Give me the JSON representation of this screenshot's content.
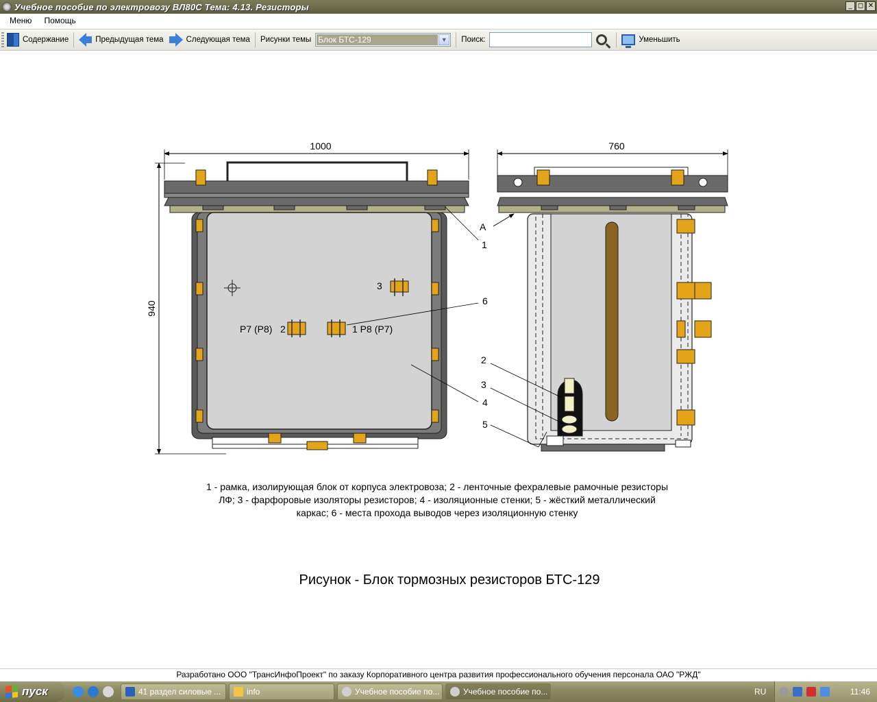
{
  "window": {
    "title": "Учебное пособие по электровозу ВЛ80С Тема: 4.13. Резисторы",
    "min_glyph": "_",
    "max_glyph": "◻",
    "close_glyph": "✕"
  },
  "menu": {
    "items": [
      "Меню",
      "Помощь"
    ]
  },
  "toolbar": {
    "contents": "Содержание",
    "prev": "Предыдущая тема",
    "next": "Следующая тема",
    "figures_label": "Рисунки темы",
    "figure_select": "Блок БТС-129",
    "search_label": "Поиск:",
    "search_value": "",
    "zoom_out": "Уменьшить"
  },
  "figure": {
    "dim_width_front": "1000",
    "dim_width_side": "760",
    "dim_height": "940",
    "labels": {
      "a": "А",
      "n1": "1",
      "n2": "2",
      "n3": "3",
      "n4": "4",
      "n5": "5",
      "n6": "6",
      "left_lead": "P7 (P8)",
      "right_lead": "1  P8 (P7)"
    },
    "legend": "1 - рамка, изолирующая блок от корпуса электровоза; 2 - ленточные фехралевые рамочные резисторы ЛФ; 3 - фарфоровые изоляторы резисторов; 4 - изоляционные стенки; 5 - жёсткий металлический каркас; 6 - места прохода выводов через изоляционную стенку",
    "caption": "Рисунок - Блок тормозных резисторов БТС-129"
  },
  "footer": "Разработано ООО \"ТрансИнфоПроект\" по заказу Корпоративного центра развития профессионального обучения персонала ОАО \"РЖД\"",
  "taskbar": {
    "start": "пуск",
    "tasks": [
      "41 раздел силовые ...",
      "info",
      "Учебное пособие по...",
      "Учебное пособие по..."
    ],
    "lang": "RU",
    "clock": "11:46"
  },
  "colors": {
    "frame_dark": "#5a5a5a",
    "panel_gray": "#d3d3d3",
    "insulator_orange": "#e3a41a",
    "rod_brown": "#8a6420",
    "rail_olive": "#b5b08c"
  }
}
